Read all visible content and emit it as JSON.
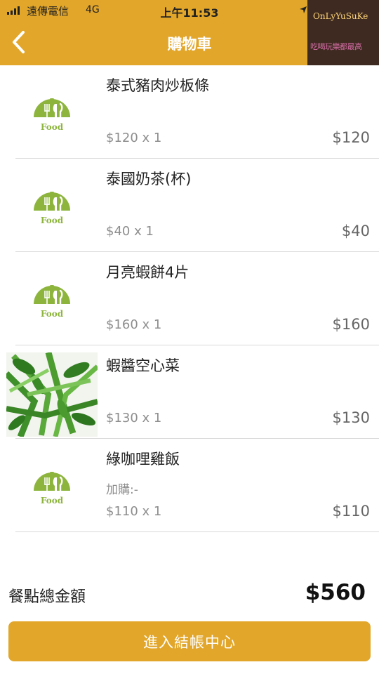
{
  "status_bar": {
    "carrier": "遠傳電信",
    "network": "4G",
    "time": "上午11:53"
  },
  "header": {
    "title": "購物車",
    "back_icon": "chevron-left-icon"
  },
  "watermark": {
    "line1": "OnLyYuSuKe",
    "line2": "吃喝玩樂都最高"
  },
  "placeholder_icon": {
    "name": "food-cloche-icon",
    "text": "Food",
    "color": "#8DB53E"
  },
  "cart": {
    "items": [
      {
        "name": "泰式豬肉炒板條",
        "addon": "",
        "qty_text": "$120 x 1",
        "price": "$120",
        "image": "food-placeholder"
      },
      {
        "name": "泰國奶茶(杯)",
        "addon": "",
        "qty_text": "$40 x 1",
        "price": "$40",
        "image": "food-placeholder"
      },
      {
        "name": "月亮蝦餅4片",
        "addon": "",
        "qty_text": "$160 x 1",
        "price": "$160",
        "image": "food-placeholder"
      },
      {
        "name": "蝦醬空心菜",
        "addon": "",
        "qty_text": "$130 x 1",
        "price": "$130",
        "image": "vegetable-photo"
      },
      {
        "name": "綠咖哩雞飯",
        "addon": "加購:-",
        "qty_text": "$110 x 1",
        "price": "$110",
        "image": "food-placeholder"
      }
    ]
  },
  "summary": {
    "total_label": "餐點總金額",
    "total_value": "$560"
  },
  "checkout": {
    "label": "進入結帳中心"
  },
  "colors": {
    "brand": "#E2A62A",
    "food_icon": "#8DB53E"
  }
}
